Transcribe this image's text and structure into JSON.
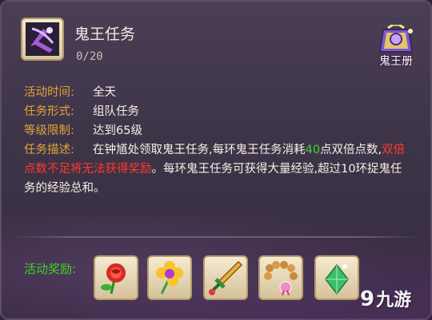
{
  "task": {
    "title": "鬼王任务",
    "progress": "0/20"
  },
  "book_button": {
    "label": "鬼王册",
    "icon": "ghost-king-book-icon"
  },
  "info": {
    "time_label": "活动时间:",
    "time_value": "全天",
    "form_label": "任务形式:",
    "form_value": "组队任务",
    "level_label": "等级限制:",
    "level_value": "达到65级",
    "desc_label": "任务描述:",
    "desc_part1": "在钟馗处领取鬼王任务,每环鬼王任务消耗",
    "desc_number": "40",
    "desc_part2": "点双倍点数,",
    "desc_warning": "双倍点数不足将无法获得奖励",
    "desc_part3": "。每环鬼王任务可获得大量经验,超过10环捉鬼任务的经验总和。"
  },
  "rewards": {
    "label": "活动奖励:",
    "items": [
      {
        "icon": "red-rose-icon"
      },
      {
        "icon": "yellow-flower-wand-icon"
      },
      {
        "icon": "golden-sword-icon"
      },
      {
        "icon": "prayer-beads-icon"
      },
      {
        "icon": "green-jade-icon"
      }
    ]
  },
  "watermark": {
    "logo": "九游",
    "mark": "9"
  },
  "colors": {
    "label": "#e3a23a",
    "highlight_green": "#43d43a",
    "warning_red": "#ff3a2a",
    "reward_label": "#3fd22a"
  }
}
